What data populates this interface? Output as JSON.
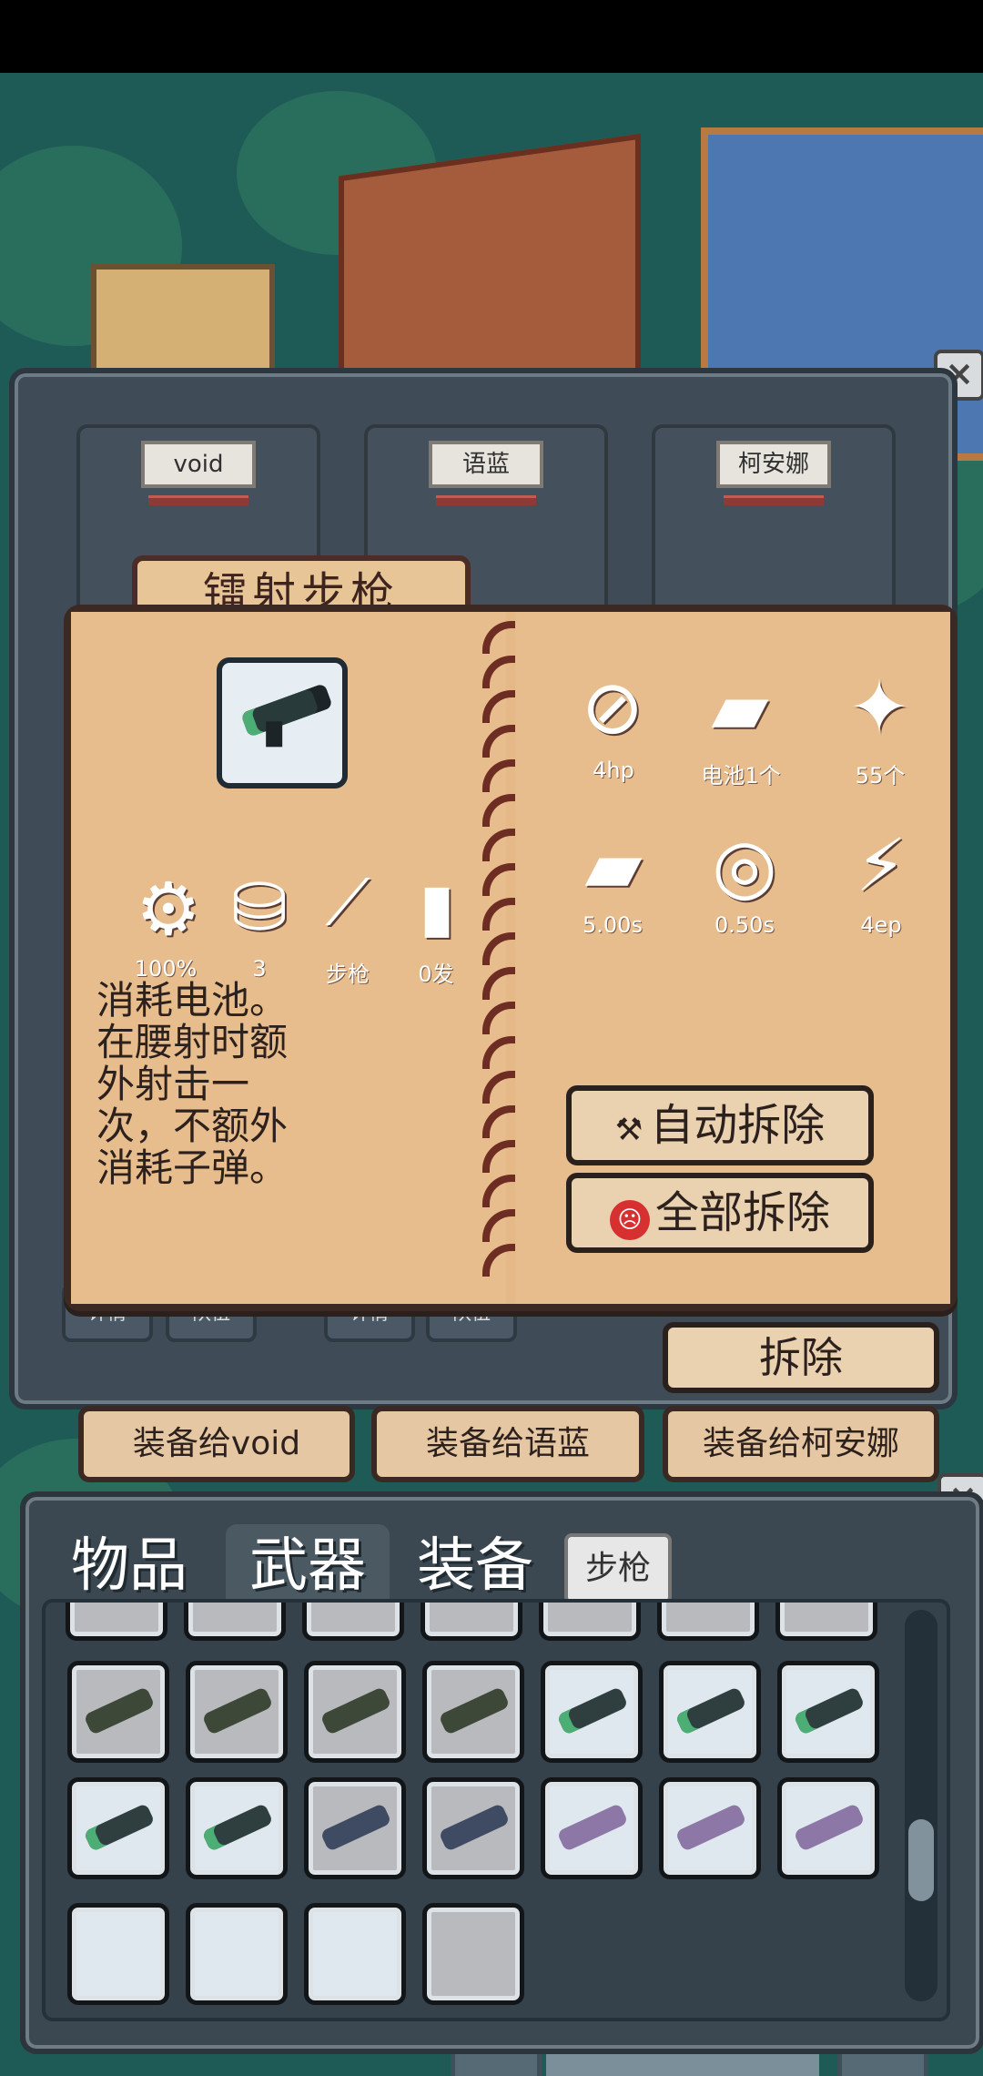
{
  "characters": [
    {
      "name": "void",
      "details": "详情",
      "team": "队伍"
    },
    {
      "name": "语蓝",
      "details": "详情",
      "team": "队伍"
    },
    {
      "name": "柯安娜"
    }
  ],
  "weapon": {
    "title": "镭射步枪",
    "stats_left": [
      {
        "icon": "gear-wrench-icon",
        "label": "100%"
      },
      {
        "icon": "weight-icon",
        "label": "3"
      },
      {
        "icon": "rifle-icon",
        "label": "步枪"
      },
      {
        "icon": "bullet-icon",
        "label": "0发"
      }
    ],
    "stats_right": [
      {
        "icon": "damage-icon",
        "label": "4hp"
      },
      {
        "icon": "magazine-icon",
        "label": "电池1个"
      },
      {
        "icon": "bullets-icon",
        "label": "55个"
      },
      {
        "icon": "reload-icon",
        "label": "5.00s"
      },
      {
        "icon": "target-icon",
        "label": "0.50s"
      },
      {
        "icon": "energy-icon",
        "label": "4ep"
      }
    ],
    "description": "消耗电池。在腰射时额外射击一次，不额外消耗子弹。"
  },
  "buttons": {
    "auto_remove": "自动拆除",
    "remove_all": "全部拆除",
    "remove": "拆除",
    "equip_void": "装备给void",
    "equip_yulan": "装备给语蓝",
    "equip_keanna": "装备给柯安娜"
  },
  "inventory": {
    "tabs": [
      "物品",
      "武器",
      "装备"
    ],
    "filter": "步枪"
  }
}
